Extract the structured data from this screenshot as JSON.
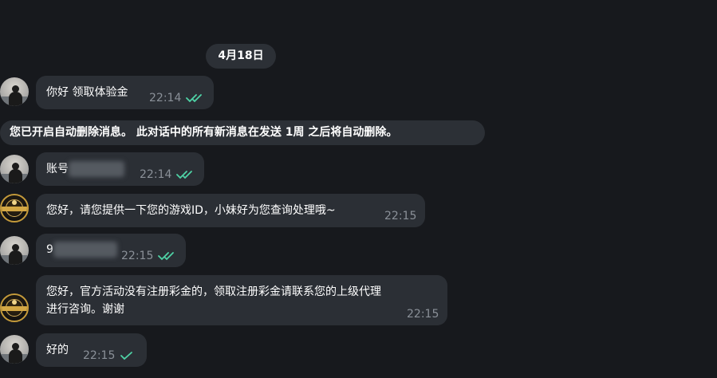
{
  "date_label": "4月18日",
  "service_notice": "您已开启自动删除消息。 此对话中的所有新消息在发送 1周 之后将自动删除。",
  "messages": [
    {
      "text": "你好 领取体验金",
      "time": "22:14",
      "read": true
    },
    {
      "text": "账号",
      "time": "22:14",
      "read": true
    },
    {
      "text": "您好，请您提供一下您的游戏ID，小妹好为您查询处理哦~",
      "time": "22:15",
      "read": false
    },
    {
      "text": "9",
      "time": "22:15",
      "read": true
    },
    {
      "line1": "您好，官方活动没有注册彩金的，领取注册彩金请联系您的上级代理",
      "line2": "进行咨询。谢谢",
      "time": "22:15",
      "read": false
    },
    {
      "text": "好的",
      "time": "22:15",
      "read": true
    }
  ],
  "colors": {
    "background": "#17191d",
    "bubble": "#2b2f35",
    "check": "#4fd3a6",
    "time": "#8a9098"
  }
}
